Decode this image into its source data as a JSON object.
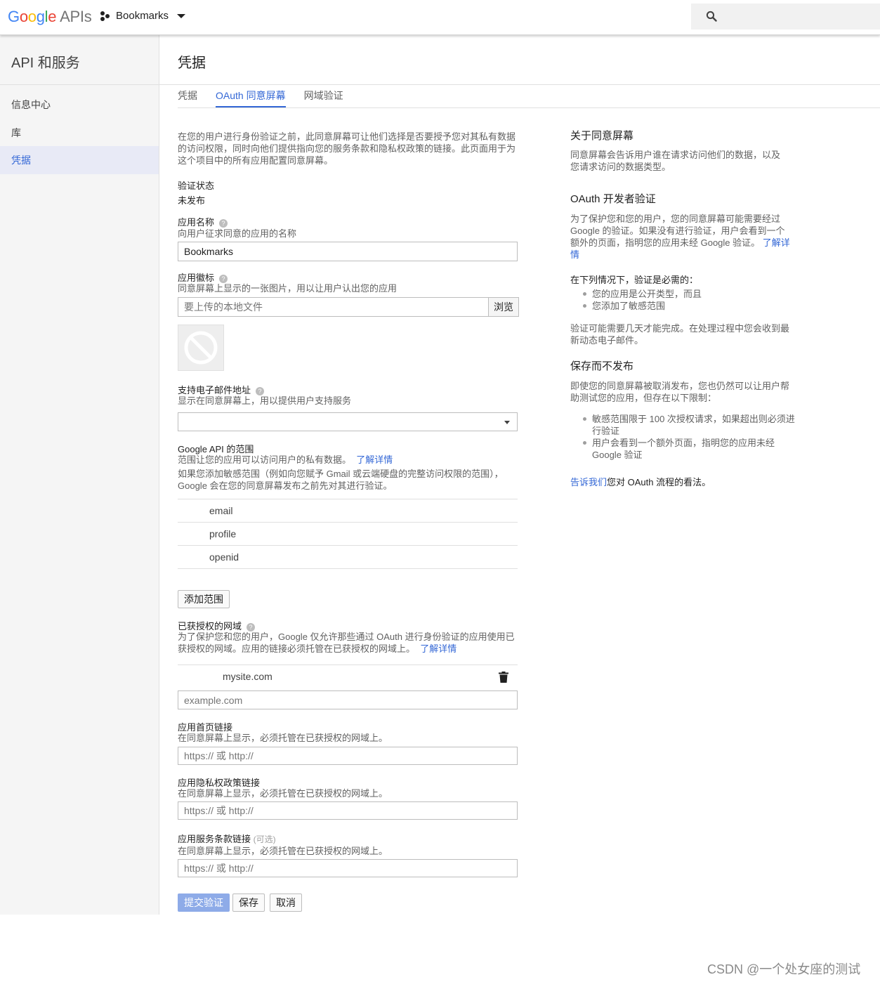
{
  "topbar": {
    "logo_letters": [
      "G",
      "o",
      "o",
      "g",
      "l",
      "e"
    ],
    "logo_suffix": "APIs",
    "project_name": "Bookmarks",
    "icons": {
      "project": "project-dots-icon",
      "dropdown": "caret-down-icon",
      "search": "search-icon"
    }
  },
  "sidebar": {
    "title": "API 和服务",
    "items": [
      {
        "label": "信息中心",
        "active": false
      },
      {
        "label": "库",
        "active": false
      },
      {
        "label": "凭据",
        "active": true
      }
    ]
  },
  "header": {
    "title": "凭据",
    "tabs": [
      {
        "label": "凭据",
        "active": false
      },
      {
        "label": "OAuth 同意屏幕",
        "active": true
      },
      {
        "label": "网域验证",
        "active": false
      }
    ]
  },
  "form": {
    "intro": "在您的用户进行身份验证之前，此同意屏幕可让他们选择是否要授予您对其私有数据的访问权限，同时向他们提供指向您的服务条款和隐私权政策的链接。此页面用于为这个项目中的所有应用配置同意屏幕。",
    "verification_status_label": "验证状态",
    "verification_status_value": "未发布",
    "app_name": {
      "label": "应用名称",
      "help": "?",
      "desc": "向用户征求同意的应用的名称",
      "value": "Bookmarks"
    },
    "app_logo": {
      "label": "应用徽标",
      "help": "?",
      "desc": "同意屏幕上显示的一张图片，用以让用户认出您的应用",
      "placeholder": "要上传的本地文件",
      "browse_label": "浏览",
      "preview_icon": "no-image-icon"
    },
    "support_email": {
      "label": "支持电子邮件地址",
      "help": "?",
      "desc": "显示在同意屏幕上，用以提供用户支持服务",
      "value": ""
    },
    "scopes": {
      "label": "Google API 的范围",
      "desc": "范围让您的应用可以访问用户的私有数据。",
      "desc_link": "了解详情",
      "note": "如果您添加敏感范围（例如向您赋予 Gmail 或云端硬盘的完整访问权限的范围），Google 会在您的同意屏幕发布之前先对其进行验证。",
      "items": [
        "email",
        "profile",
        "openid"
      ],
      "add_button": "添加范围"
    },
    "authorized_domains": {
      "label": "已获授权的网域",
      "help": "?",
      "desc": "为了保护您和您的用户，Google 仅允许那些通过 OAuth 进行身份验证的应用使用已获授权的网域。应用的链接必须托管在已获授权的网域上。",
      "desc_link": "了解详情",
      "items": [
        "mysite.com"
      ],
      "placeholder": "example.com",
      "delete_icon": "trash-icon"
    },
    "homepage": {
      "label": "应用首页链接",
      "desc": "在同意屏幕上显示，必须托管在已获授权的网域上。",
      "placeholder": "https:// 或 http://"
    },
    "privacy": {
      "label": "应用隐私权政策链接",
      "desc": "在同意屏幕上显示，必须托管在已获授权的网域上。",
      "placeholder": "https:// 或 http://"
    },
    "tos": {
      "label": "应用服务条款链接",
      "optional": "(可选)",
      "desc": "在同意屏幕上显示，必须托管在已获授权的网域上。",
      "placeholder": "https:// 或 http://"
    },
    "buttons": {
      "submit": "提交验证",
      "save": "保存",
      "cancel": "取消"
    }
  },
  "info": {
    "about_title": "关于同意屏幕",
    "about_text": "同意屏幕会告诉用户谁在请求访问他们的数据，以及您请求访问的数据类型。",
    "dev_title": "OAuth 开发者验证",
    "dev_text": "为了保护您和您的用户，您的同意屏幕可能需要经过 Google 的验证。如果没有进行验证，用户会看到一个额外的页面，指明您的应用未经 Google 验证。",
    "dev_link": "了解详情",
    "required_title": "在下列情况下，验证是必需的：",
    "required_items": [
      "您的应用是公开类型，而且",
      "您添加了敏感范围"
    ],
    "days_text": "验证可能需要几天才能完成。在处理过程中您会收到最新动态电子邮件。",
    "save_title": "保存而不发布",
    "save_text": "即使您的同意屏幕被取消发布，您也仍然可以让用户帮助测试您的应用，但存在以下限制：",
    "limits": [
      "敏感范围限于 100 次授权请求，如果超出则必须进行验证",
      "用户会看到一个额外页面，指明您的应用未经 Google 验证"
    ],
    "feedback_link": "告诉我们",
    "feedback_text": "您对 OAuth 流程的看法。"
  },
  "watermark": "CSDN @一个处女座的测试"
}
